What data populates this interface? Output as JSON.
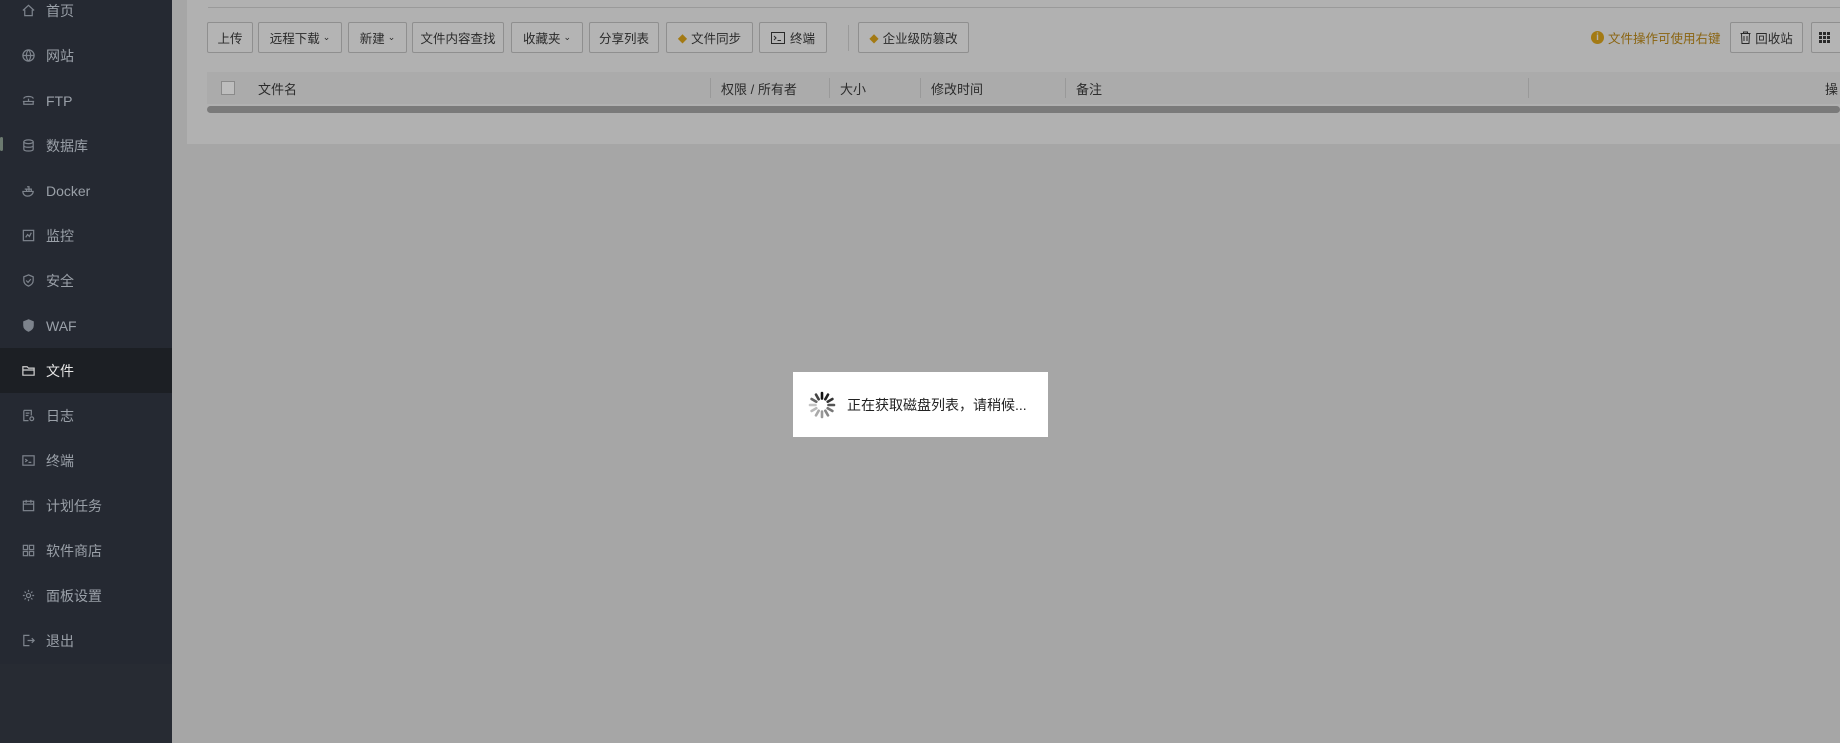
{
  "sidebar": {
    "items": [
      {
        "label": "首页",
        "icon": "home-icon"
      },
      {
        "label": "网站",
        "icon": "globe-icon"
      },
      {
        "label": "FTP",
        "icon": "ftp-icon"
      },
      {
        "label": "数据库",
        "icon": "database-icon"
      },
      {
        "label": "Docker",
        "icon": "docker-icon"
      },
      {
        "label": "监控",
        "icon": "monitor-icon"
      },
      {
        "label": "安全",
        "icon": "shield-icon"
      },
      {
        "label": "WAF",
        "icon": "waf-icon"
      },
      {
        "label": "文件",
        "icon": "folder-icon",
        "active": true
      },
      {
        "label": "日志",
        "icon": "log-icon"
      },
      {
        "label": "终端",
        "icon": "terminal-icon"
      },
      {
        "label": "计划任务",
        "icon": "calendar-icon"
      },
      {
        "label": "软件商店",
        "icon": "apps-icon"
      },
      {
        "label": "面板设置",
        "icon": "gear-icon"
      },
      {
        "label": "退出",
        "icon": "logout-icon"
      }
    ]
  },
  "toolbar": {
    "upload": "上传",
    "remote_download": "远程下载",
    "new": "新建",
    "content_search": "文件内容查找",
    "favorites": "收藏夹",
    "share_list": "分享列表",
    "file_sync": "文件同步",
    "terminal": "终端",
    "tamper_proof": "企业级防篡改",
    "hint": "文件操作可使用右键",
    "recycle_bin": "回收站"
  },
  "table": {
    "columns": [
      "文件名",
      "权限 / 所有者",
      "大小",
      "修改时间",
      "备注",
      "操"
    ]
  },
  "loading": {
    "text": "正在获取磁盘列表，请稍候..."
  },
  "colors": {
    "accent_gold": "#a37a14",
    "sidebar_bg": "#252932",
    "overlay_bg": "#a6a6a6"
  }
}
